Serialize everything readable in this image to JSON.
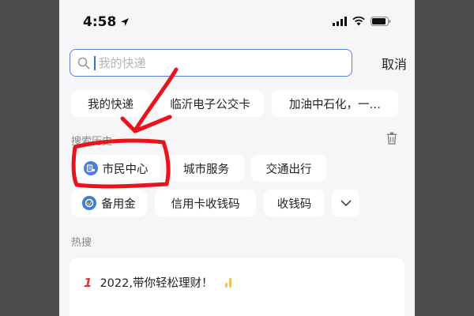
{
  "status_bar": {
    "time": "4:58"
  },
  "search": {
    "placeholder": "我的快递",
    "cancel_label": "取消"
  },
  "suggestions": [
    "我的快递",
    "临沂电子公交卡",
    "加油中石化，一…"
  ],
  "history": {
    "title": "搜索历史",
    "items": [
      "市民中心",
      "城市服务",
      "交通出行",
      "备用金",
      "信用卡收钱码",
      "收钱码"
    ]
  },
  "hot": {
    "title": "热搜",
    "items": [
      {
        "rank": "1",
        "text": "2022,带你轻松理财！"
      }
    ]
  },
  "colors": {
    "accent": "#3a6fe0",
    "annotation": "#e8141b",
    "rank": "#e0342c"
  }
}
